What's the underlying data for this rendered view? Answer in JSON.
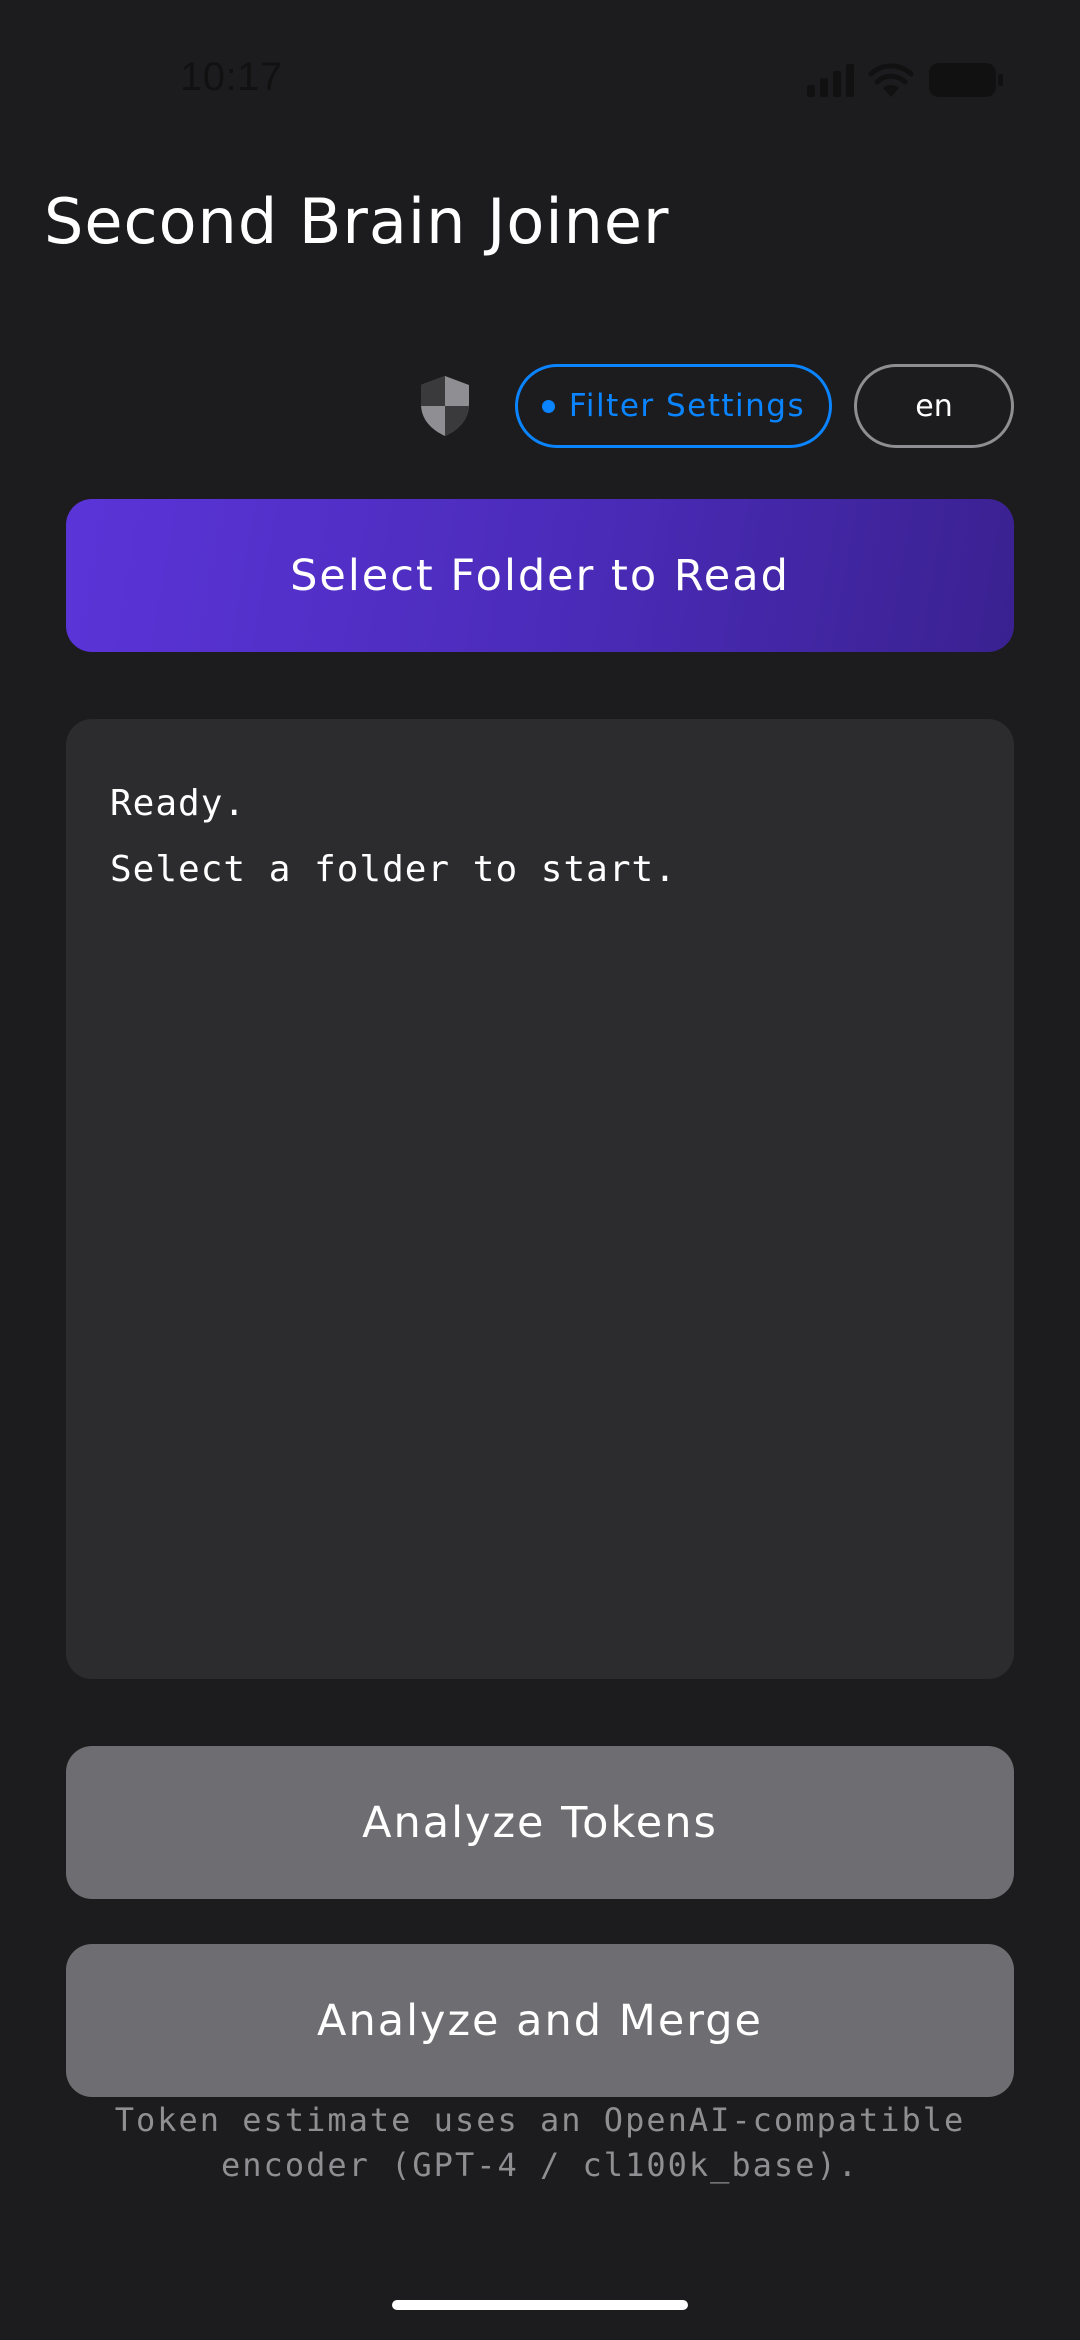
{
  "status_bar": {
    "time": "10:17",
    "icons": [
      "signal-icon",
      "wifi-icon",
      "battery-icon"
    ]
  },
  "header": {
    "title": "Second Brain Joiner"
  },
  "toolbar": {
    "privacy_icon": "shield-icon",
    "filter_label": "Filter Settings",
    "language_label": "en"
  },
  "actions": {
    "select_folder_label": "Select Folder to Read",
    "analyze_tokens_label": "Analyze Tokens",
    "analyze_merge_label": "Analyze and Merge"
  },
  "log": {
    "lines": [
      "Ready.",
      "Select a folder to start."
    ]
  },
  "footnote": {
    "line1": "Token estimate uses an OpenAI-compatible",
    "line2": "encoder (GPT-4 / cl100k_base)."
  },
  "colors": {
    "background": "#1c1c1e",
    "panel": "#2c2c2e",
    "accent_blue": "#0a84ff",
    "primary_gradient_start": "#5b34d8",
    "primary_gradient_end": "#3a2190",
    "button_gray": "#6e6e72",
    "muted_text": "#8e8e93"
  }
}
